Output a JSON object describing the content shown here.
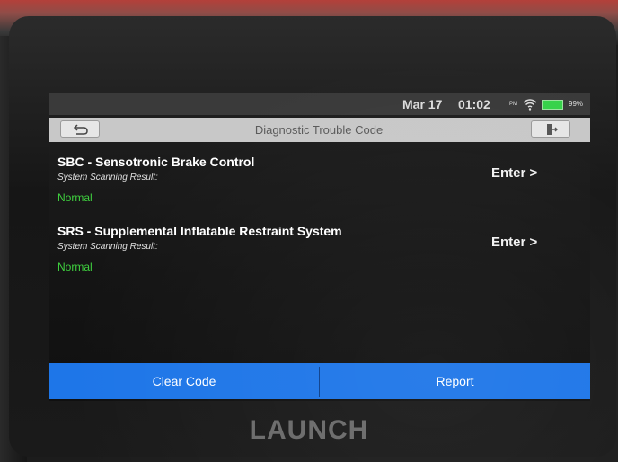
{
  "status": {
    "date": "Mar 17",
    "time": "01:02",
    "ampm": "PM",
    "battery": "99%",
    "battery_color": "#36d24a"
  },
  "header": {
    "title": "Diagnostic Trouble Code",
    "back_icon": "back-arrow-icon",
    "exit_icon": "exit-door-icon"
  },
  "systems": [
    {
      "title": "SBC - Sensotronic Brake Control",
      "subtitle": "System Scanning Result:",
      "status": "Normal",
      "action": "Enter >"
    },
    {
      "title": "SRS - Supplemental Inflatable Restraint System",
      "subtitle": "System Scanning Result:",
      "status": "Normal",
      "action": "Enter >"
    }
  ],
  "footer": {
    "clear_label": "Clear Code",
    "report_label": "Report",
    "bar_color": "#1e76e8"
  },
  "device": {
    "brand": "LAUNCH"
  }
}
